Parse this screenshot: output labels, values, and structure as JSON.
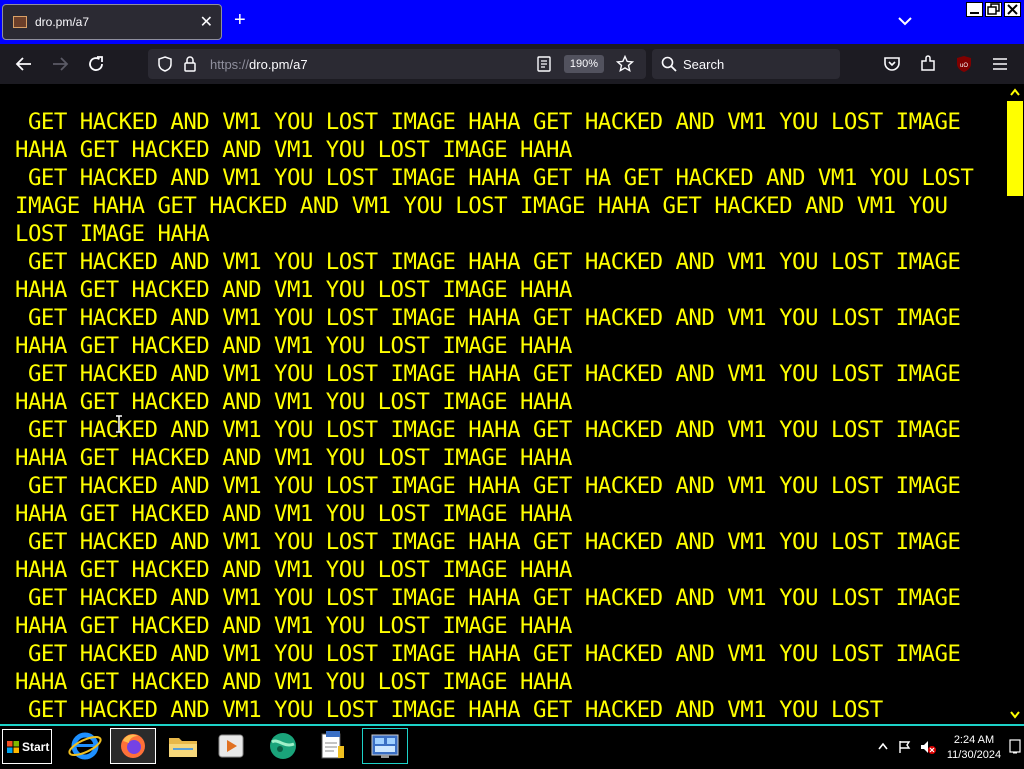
{
  "browser": {
    "tab": {
      "title": "dro.pm/a7",
      "close": "✕"
    },
    "new_tab": "+",
    "url_protocol": "https://",
    "url_host": "dro.pm/a7",
    "zoom": "190%",
    "search_placeholder": "Search"
  },
  "page": {
    "text": " GET HACKED AND VM1 YOU LOST IMAGE HAHA GET HACKED AND VM1 YOU LOST IMAGE HAHA GET HACKED AND VM1 YOU LOST IMAGE HAHA\n GET HACKED AND VM1 YOU LOST IMAGE HAHA GET HA GET HACKED AND VM1 YOU LOST IMAGE HAHA GET HACKED AND VM1 YOU LOST IMAGE HAHA GET HACKED AND VM1 YOU LOST IMAGE HAHA\n GET HACKED AND VM1 YOU LOST IMAGE HAHA GET HACKED AND VM1 YOU LOST IMAGE HAHA GET HACKED AND VM1 YOU LOST IMAGE HAHA\n GET HACKED AND VM1 YOU LOST IMAGE HAHA GET HACKED AND VM1 YOU LOST IMAGE HAHA GET HACKED AND VM1 YOU LOST IMAGE HAHA\n GET HACKED AND VM1 YOU LOST IMAGE HAHA GET HACKED AND VM1 YOU LOST IMAGE HAHA GET HACKED AND VM1 YOU LOST IMAGE HAHA\n GET HACKED AND VM1 YOU LOST IMAGE HAHA GET HACKED AND VM1 YOU LOST IMAGE HAHA GET HACKED AND VM1 YOU LOST IMAGE HAHA\n GET HACKED AND VM1 YOU LOST IMAGE HAHA GET HACKED AND VM1 YOU LOST IMAGE HAHA GET HACKED AND VM1 YOU LOST IMAGE HAHA\n GET HACKED AND VM1 YOU LOST IMAGE HAHA GET HACKED AND VM1 YOU LOST IMAGE HAHA GET HACKED AND VM1 YOU LOST IMAGE HAHA\n GET HACKED AND VM1 YOU LOST IMAGE HAHA GET HACKED AND VM1 YOU LOST IMAGE HAHA GET HACKED AND VM1 YOU LOST IMAGE HAHA\n GET HACKED AND VM1 YOU LOST IMAGE HAHA GET HACKED AND VM1 YOU LOST IMAGE HAHA GET HACKED AND VM1 YOU LOST IMAGE HAHA\n GET HACKED AND VM1 YOU LOST IMAGE HAHA GET HACKED AND VM1 YOU LOST",
    "text_color": "#ffff00",
    "background_color": "#000000",
    "scrollbar_thumb_color": "#ffff00"
  },
  "taskbar": {
    "start_label": "Start",
    "apps": [
      "internet-explorer-icon",
      "firefox-icon",
      "file-explorer-icon",
      "media-player-icon",
      "browser-globe-icon",
      "notepad-icon",
      "control-panel-icon"
    ],
    "clock_time": "2:24 AM",
    "clock_date": "11/30/2024",
    "accent_color": "#1dd2c8"
  },
  "titlebar_color": "#0000ff"
}
